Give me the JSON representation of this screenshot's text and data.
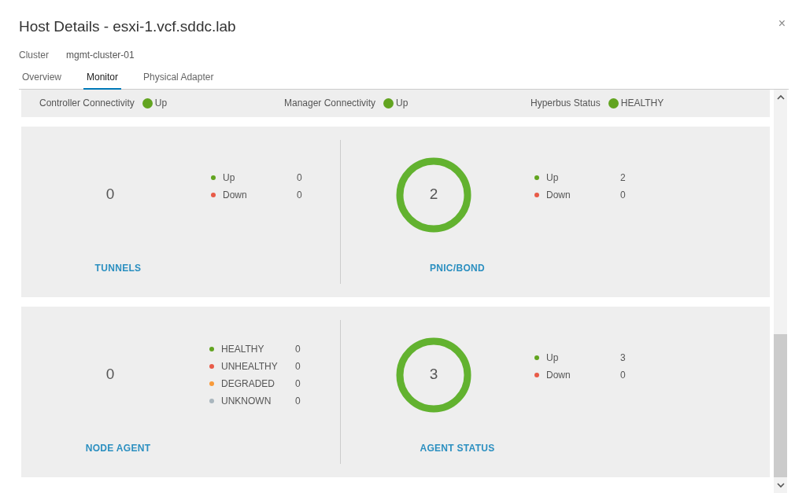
{
  "dialog": {
    "title": "Host Details - esxi-1.vcf.sddc.lab",
    "close": "×",
    "meta": {
      "label": "Cluster",
      "value": "mgmt-cluster-01"
    }
  },
  "tabs": [
    {
      "label": "Overview",
      "selected": false
    },
    {
      "label": "Monitor",
      "selected": true
    },
    {
      "label": "Physical Adapter",
      "selected": false
    }
  ],
  "status_strip": [
    {
      "label": "Controller Connectivity",
      "value": "Up"
    },
    {
      "label": "Manager Connectivity",
      "value": "Up"
    },
    {
      "label": "Hyperbus Status",
      "value": "HEALTHY"
    }
  ],
  "cards": [
    {
      "panels": [
        {
          "title": "TUNNELS",
          "total": "0",
          "ring": false,
          "legend": [
            {
              "label": "Up",
              "value": "0",
              "color": "#62a420"
            },
            {
              "label": "Down",
              "value": "0",
              "color": "#e85b48"
            }
          ]
        },
        {
          "title": "PNIC/BOND",
          "total": "2",
          "ring": true,
          "legend": [
            {
              "label": "Up",
              "value": "2",
              "color": "#62a420"
            },
            {
              "label": "Down",
              "value": "0",
              "color": "#e85b48"
            }
          ]
        }
      ]
    },
    {
      "panels": [
        {
          "title": "NODE AGENT",
          "total": "0",
          "ring": false,
          "legend": [
            {
              "label": "HEALTHY",
              "value": "0",
              "color": "#62a420"
            },
            {
              "label": "UNHEALTHY",
              "value": "0",
              "color": "#e85b48"
            },
            {
              "label": "DEGRADED",
              "value": "0",
              "color": "#f89a3a"
            },
            {
              "label": "UNKNOWN",
              "value": "0",
              "color": "#a9b6be"
            }
          ]
        },
        {
          "title": "AGENT STATUS",
          "total": "3",
          "ring": true,
          "legend": [
            {
              "label": "Up",
              "value": "3",
              "color": "#62a420"
            },
            {
              "label": "Down",
              "value": "0",
              "color": "#e85b48"
            }
          ]
        }
      ]
    }
  ]
}
